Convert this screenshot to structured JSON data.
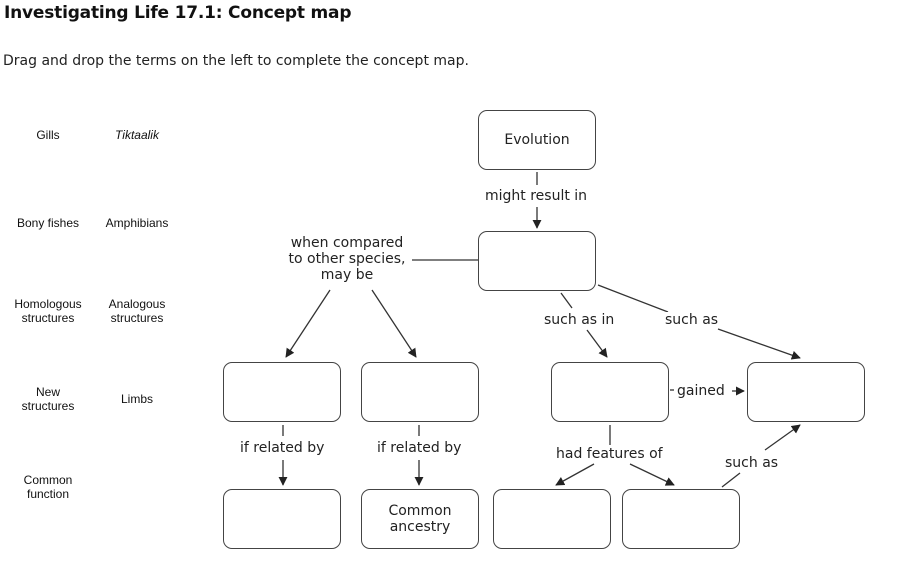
{
  "header": {
    "title": "Investigating Life 17.1: Concept map",
    "instructions": "Drag and drop the terms on the left to complete the concept map."
  },
  "terms": [
    {
      "label": "Gills",
      "italic": false
    },
    {
      "label": "Tiktaalik",
      "italic": true
    },
    {
      "label": "Bony fishes",
      "italic": false
    },
    {
      "label": "Amphibians",
      "italic": false
    },
    {
      "label": "Homologous structures",
      "italic": false
    },
    {
      "label": "Analogous structures",
      "italic": false
    },
    {
      "label": "New structures",
      "italic": false
    },
    {
      "label": "Limbs",
      "italic": false
    },
    {
      "label": "Common function",
      "italic": false
    }
  ],
  "concept_map": {
    "nodes": {
      "evolution": "Evolution",
      "result": "",
      "compare_left": "",
      "compare_right": "",
      "such_as_in": "",
      "gained_target": "",
      "related_left": "",
      "common_ancestry": "Common ancestry",
      "features_left": "",
      "features_right": ""
    },
    "links": {
      "might_result_in": "might result in",
      "when_compared": "when compared to other species, may be",
      "such_as_in": "such as in",
      "such_as_top": "such as",
      "gained": "gained",
      "if_related_by_1": "if related by",
      "if_related_by_2": "if related by",
      "had_features_of": "had features of",
      "such_as_bottom": "such as"
    }
  }
}
